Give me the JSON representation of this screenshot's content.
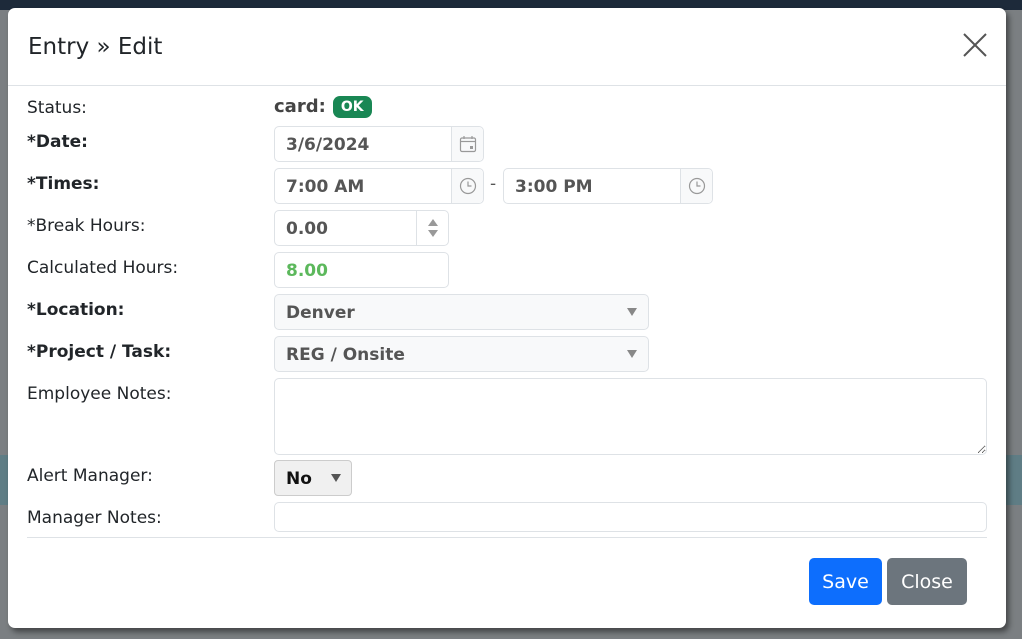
{
  "modal": {
    "title": "Entry » Edit",
    "close_icon": "close-icon"
  },
  "form": {
    "status": {
      "label": "Status:",
      "text": "card",
      "separator": ":",
      "badge": "OK",
      "badge_color": "#198754"
    },
    "date": {
      "label": "*Date:",
      "value": "3/6/2024",
      "icon": "calendar-icon"
    },
    "times": {
      "label": "*Times:",
      "start": "7:00 AM",
      "end": "3:00 PM",
      "separator": "-",
      "icon": "clock-icon"
    },
    "break_hours": {
      "label": "*Break Hours:",
      "value": "0.00"
    },
    "calculated_hours": {
      "label": "Calculated Hours:",
      "value": "8.00",
      "color": "#5cb85c"
    },
    "location": {
      "label": "*Location:",
      "value": "Denver"
    },
    "project_task": {
      "label": "*Project / Task:",
      "value": "REG / Onsite"
    },
    "employee_notes": {
      "label": "Employee Notes:",
      "value": ""
    },
    "alert_manager": {
      "label": "Alert Manager:",
      "value": "No"
    },
    "manager_notes": {
      "label": "Manager Notes:",
      "value": ""
    }
  },
  "footer": {
    "save_label": "Save",
    "close_label": "Close",
    "save_color": "#0d6efd",
    "close_color": "#6c757d"
  }
}
